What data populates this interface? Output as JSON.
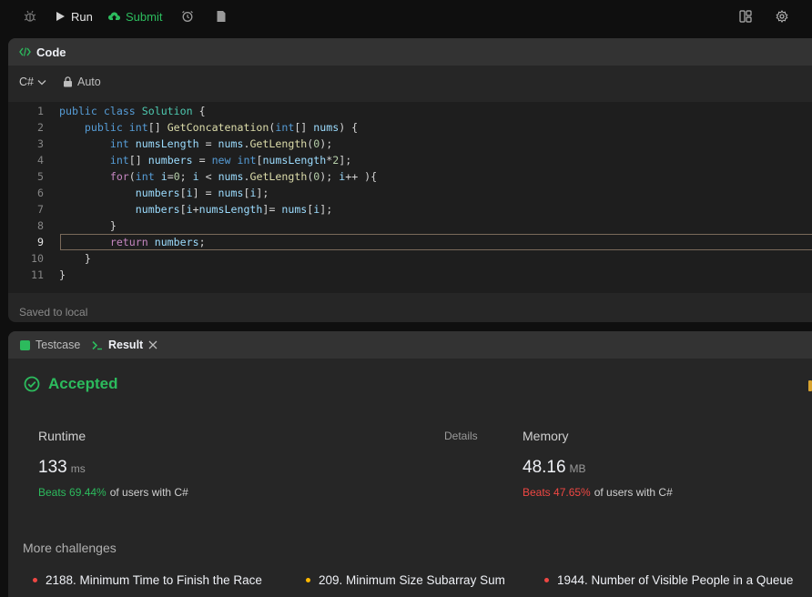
{
  "toolbar": {
    "run_label": "Run",
    "submit_label": "Submit"
  },
  "code_panel": {
    "title": "Code",
    "language": "C#",
    "mode": "Auto",
    "status": "Saved to local"
  },
  "editor": {
    "lines": [
      {
        "n": "1"
      },
      {
        "n": "2"
      },
      {
        "n": "3"
      },
      {
        "n": "4"
      },
      {
        "n": "5"
      },
      {
        "n": "6"
      },
      {
        "n": "7"
      },
      {
        "n": "8"
      },
      {
        "n": "9"
      },
      {
        "n": "10"
      },
      {
        "n": "11"
      }
    ]
  },
  "result_panel": {
    "tabs": {
      "testcase": "Testcase",
      "result": "Result"
    },
    "verdict": "Accepted",
    "details_label": "Details",
    "runtime": {
      "label": "Runtime",
      "value": "133",
      "unit": "ms",
      "beats": "Beats 69.44%",
      "suffix": "of users with C#"
    },
    "memory": {
      "label": "Memory",
      "value": "48.16",
      "unit": "MB",
      "beats": "Beats 47.65%",
      "suffix": "of users with C#"
    },
    "more_title": "More challenges",
    "challenges": [
      {
        "title": "2188. Minimum Time to Finish the Race",
        "dot_color": "#ef4743"
      },
      {
        "title": "209. Minimum Size Subarray Sum",
        "dot_color": "#ffb800"
      },
      {
        "title": "1944. Number of Visible People in a Queue",
        "dot_color": "#ef4743"
      }
    ]
  },
  "colors": {
    "accent_green": "#2cbb5d",
    "accent_red": "#ef4743"
  }
}
